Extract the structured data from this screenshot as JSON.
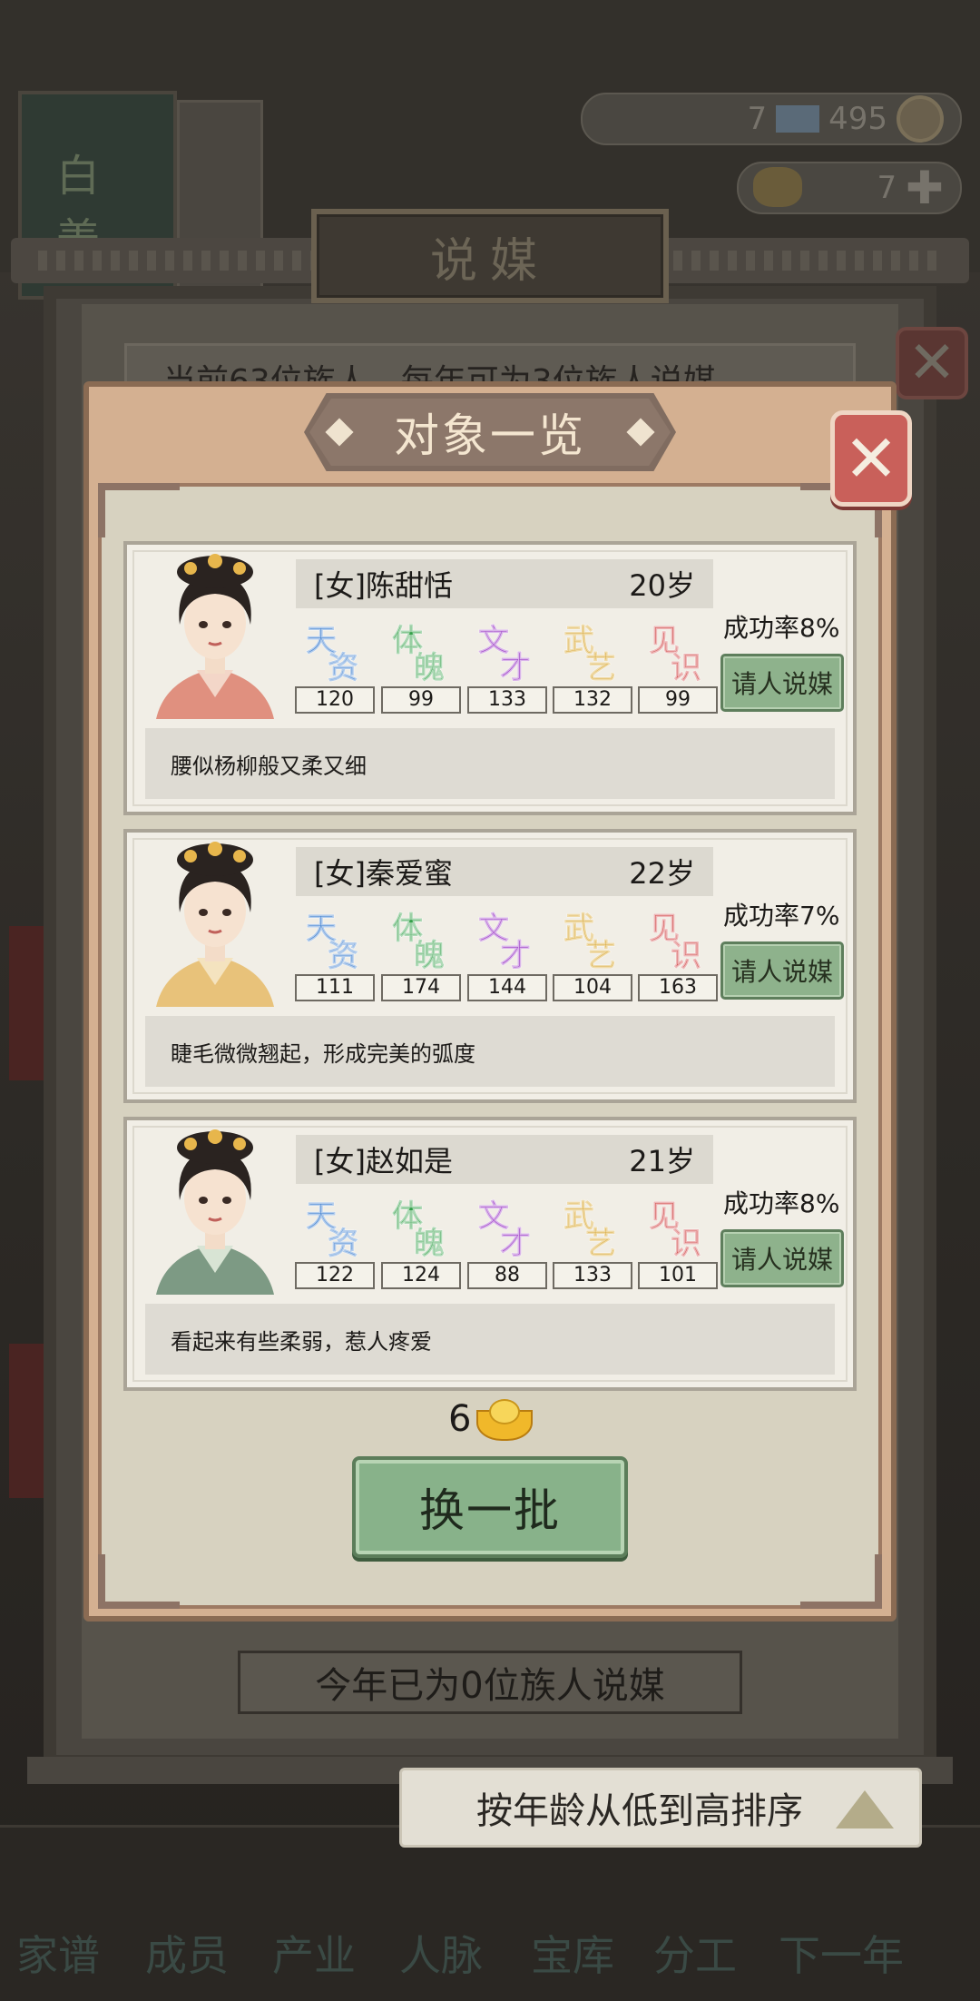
{
  "background": {
    "resources": {
      "currency_count": "7",
      "coin_count": "495",
      "ingot_count": "7"
    },
    "outer_dialog": {
      "title": "说媒",
      "summary": "当前63位族人，每年可为3位族人说媒",
      "this_year": "今年已为0位族人说媒",
      "close_icon": "close-icon"
    },
    "sort_button": "按年龄从低到高排序",
    "nav": [
      "家谱",
      "成员",
      "产业",
      "人脉",
      "宝库",
      "分工",
      "下一年"
    ]
  },
  "dialog": {
    "title": "对象一览",
    "close_icon": "close-icon",
    "stat_labels": [
      {
        "top": "天",
        "bottom": "资",
        "color": "#3f7fcf"
      },
      {
        "top": "体",
        "bottom": "魄",
        "color": "#35a04a"
      },
      {
        "top": "文",
        "bottom": "才",
        "color": "#a045c8"
      },
      {
        "top": "武",
        "bottom": "艺",
        "color": "#d6a227"
      },
      {
        "top": "见",
        "bottom": "识",
        "color": "#d24d4d"
      }
    ],
    "candidates": [
      {
        "name": "[女]陈甜恬",
        "age": "20岁",
        "stats": [
          "120",
          "99",
          "133",
          "132",
          "99"
        ],
        "success_rate": "成功率8%",
        "action": "请人说媒",
        "description": "腰似杨柳般又柔又细"
      },
      {
        "name": "[女]秦爱蜜",
        "age": "22岁",
        "stats": [
          "111",
          "174",
          "144",
          "104",
          "163"
        ],
        "success_rate": "成功率7%",
        "action": "请人说媒",
        "description": "睫毛微微翘起，形成完美的弧度"
      },
      {
        "name": "[女]赵如是",
        "age": "21岁",
        "stats": [
          "122",
          "124",
          "88",
          "133",
          "101"
        ],
        "success_rate": "成功率8%",
        "action": "请人说媒",
        "description": "看起来有些柔弱，惹人疼爱"
      }
    ],
    "refresh_cost": "6",
    "refresh_cost_icon": "gold-ingot-icon",
    "refresh_button": "换一批"
  }
}
